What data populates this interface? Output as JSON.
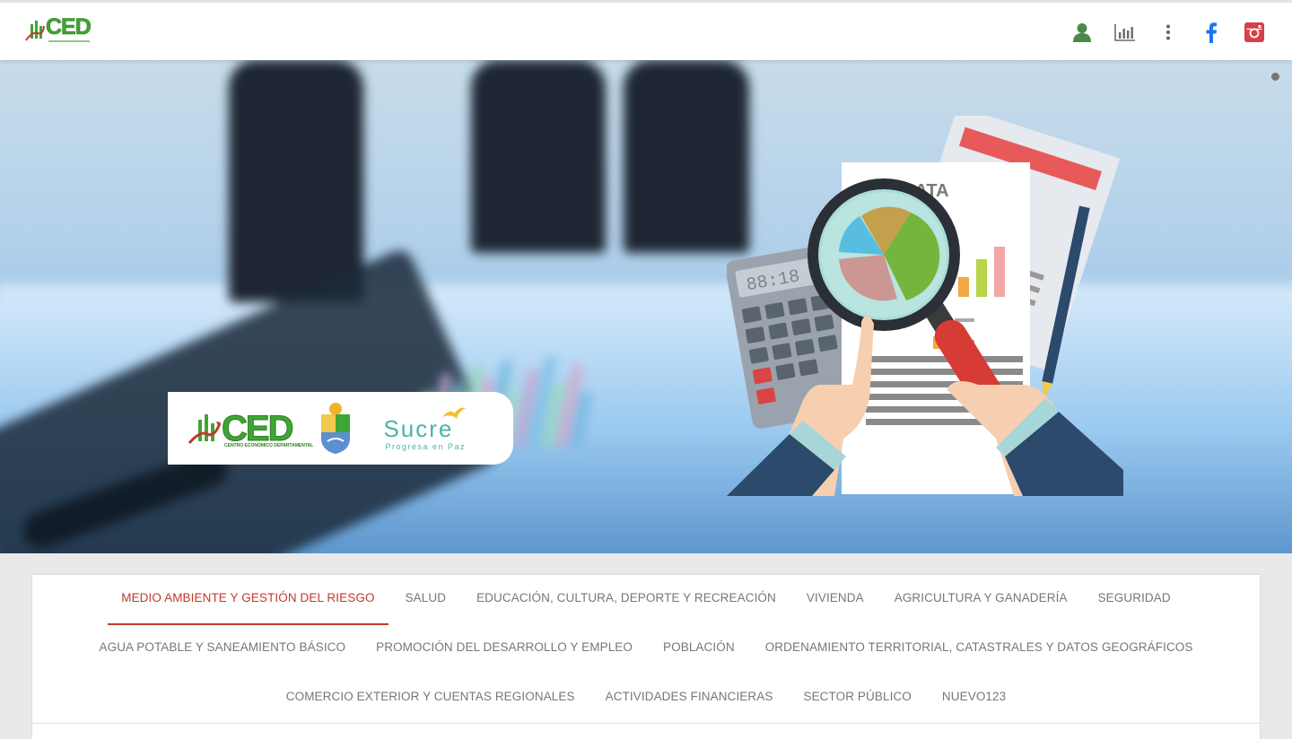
{
  "header": {
    "logo_text": "CED",
    "icons": [
      "user-icon",
      "stats-chart-icon",
      "more-vertical-icon",
      "facebook-icon",
      "instagram-icon"
    ]
  },
  "hero": {
    "card": {
      "ced_text": "CED",
      "ced_subtitle": "CENTRO ECONÓMICO DEPARTAMENTAL",
      "sucre_word": "Sucre",
      "sucre_tagline": "Progresa en Paz"
    },
    "illustration_sheet_label": "DATA"
  },
  "categories": {
    "row1": [
      {
        "label": "MEDIO AMBIENTE Y GESTIÓN DEL RIESGO",
        "active": true
      },
      {
        "label": "SALUD"
      },
      {
        "label": "EDUCACIÓN, CULTURA, DEPORTE Y RECREACIÓN"
      },
      {
        "label": "VIVIENDA"
      },
      {
        "label": "AGRICULTURA Y GANADERÍA"
      },
      {
        "label": "SEGURIDAD"
      }
    ],
    "row2": [
      {
        "label": "AGUA POTABLE Y SANEAMIENTO BÁSICO"
      },
      {
        "label": "PROMOCIÓN DEL DESARROLLO Y EMPLEO"
      },
      {
        "label": "POBLACIÓN"
      },
      {
        "label": "ORDENAMIENTO TERRITORIAL, CATASTRALES Y DATOS GEOGRÁFICOS"
      }
    ],
    "row3": [
      {
        "label": "COMERCIO EXTERIOR Y CUENTAS REGIONALES"
      },
      {
        "label": "ACTIVIDADES FINANCIERAS"
      },
      {
        "label": "SECTOR PÚBLICO"
      },
      {
        "label": "NUEVO123"
      }
    ]
  },
  "colors": {
    "brand_green": "#3fa535",
    "active_red": "#c0392b",
    "facebook_blue": "#1877f2",
    "instagram_red": "#d6404a",
    "user_green": "#4a8a4a"
  }
}
